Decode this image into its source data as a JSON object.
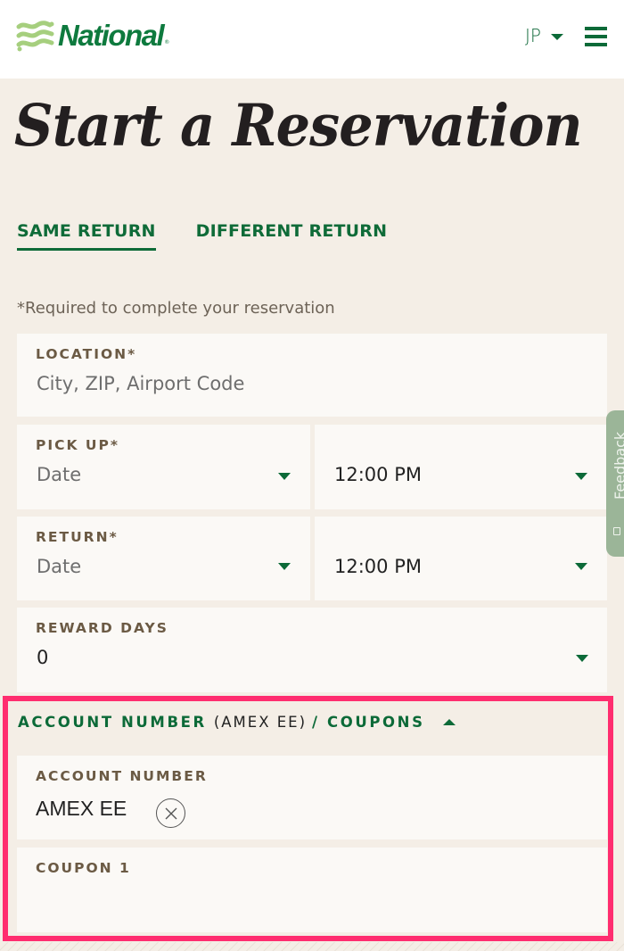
{
  "header": {
    "brand": "National",
    "brand_mark": "®",
    "language": "JP",
    "menu_icon": "hamburger-menu-icon",
    "brand_color": "#0e7a3e"
  },
  "page_title": "Start a Reservation",
  "tabs": [
    {
      "label": "SAME RETURN",
      "active": true
    },
    {
      "label": "DIFFERENT RETURN",
      "active": false
    }
  ],
  "required_note": "*Required to complete your reservation",
  "form": {
    "location": {
      "label": "LOCATION*",
      "placeholder": "City, ZIP, Airport Code"
    },
    "pickup": {
      "label": "PICK UP*",
      "date_placeholder": "Date",
      "time_value": "12:00 PM"
    },
    "return": {
      "label": "RETURN*",
      "date_placeholder": "Date",
      "time_value": "12:00 PM"
    },
    "reward_days": {
      "label": "REWARD DAYS",
      "value": "0"
    }
  },
  "account_section": {
    "title_prefix": "ACCOUNT NUMBER",
    "title_account": "(AMEX EE)",
    "title_suffix": "/ COUPONS",
    "expanded": true,
    "account_number": {
      "label": "ACCOUNT NUMBER",
      "value": "AMEX EE"
    },
    "coupon_1": {
      "label": "COUPON 1",
      "value": ""
    },
    "highlight_color": "#ff2d6f"
  },
  "feedback": {
    "label": "Feedback"
  }
}
